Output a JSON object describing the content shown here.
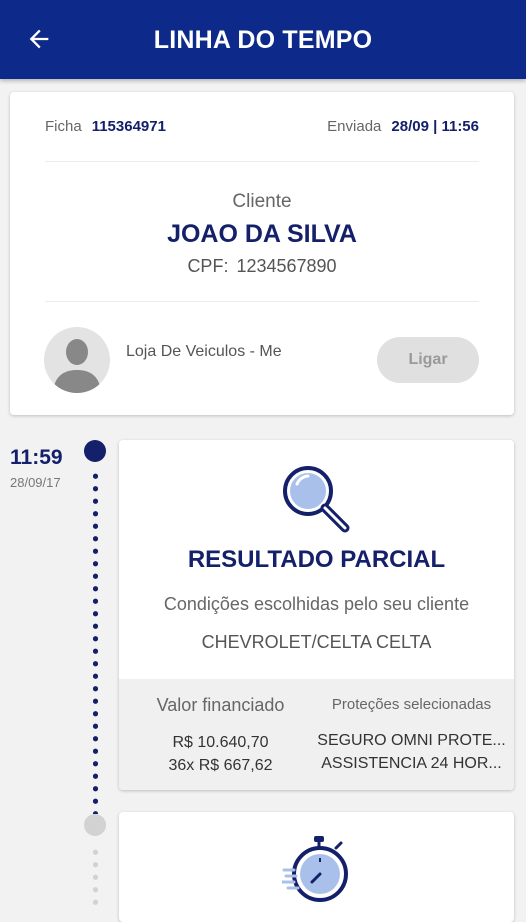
{
  "header": {
    "title": "LINHA DO TEMPO",
    "back_icon": "arrow-left-icon",
    "color": "#0d2a8a"
  },
  "client_card": {
    "ficha_label": "Ficha",
    "ficha_value": "115364971",
    "enviada_label": "Enviada",
    "enviada_value": "28/09 | 11:56",
    "cliente_label": "Cliente",
    "cliente_name": "JOAO DA SILVA",
    "cpf_label": "CPF:",
    "cpf_value": "1234567890",
    "store_name": "Loja De Veiculos - Me",
    "call_button": "Ligar",
    "avatar_icon": "person-avatar-icon"
  },
  "timeline": {
    "time": "11:59",
    "date": "28/09/17",
    "active_color": "#14206a",
    "inactive_color": "#d2d2d2"
  },
  "result_card": {
    "icon": "magnifier-icon",
    "title": "RESULTADO PARCIAL",
    "subtitle": "Condições escolhidas pelo seu cliente",
    "vehicle": "CHEVROLET/CELTA CELTA",
    "financed_label": "Valor financiado",
    "financed_value": "R$ 10.640,70",
    "installments": "36x R$ 667,62",
    "protections_label": "Proteções selecionadas",
    "protections": [
      "SEGURO OMNI PROTE...",
      "ASSISTENCIA 24 HOR..."
    ]
  },
  "next_card": {
    "icon": "stopwatch-icon"
  }
}
